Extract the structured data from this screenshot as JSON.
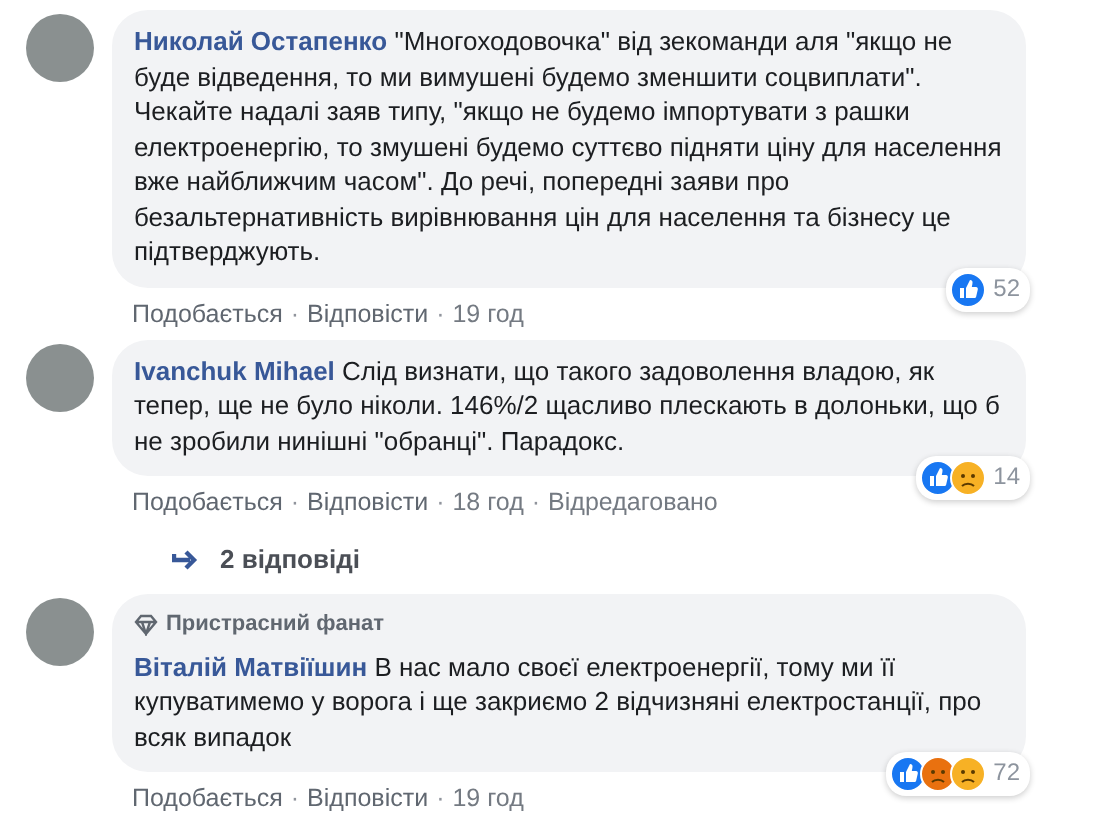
{
  "comments": [
    {
      "author": "Николай Остапенко",
      "text": "\"Многоходовочка\" від зекоманди аля \"якщо не буде відведення, то ми вимушені будемо зменшити соцвиплати\". Чекайте надалі заяв типу, \"якщо не будемо імпортувати з рашки електроенергію, то змушені будемо суттєво підняти ціну для населення вже найближчим часом\". До речі, попередні заяви про безальтернативність вирівнювання цін для населення та бізнесу це підтверджують.",
      "reactions": [
        {
          "kind": "like"
        }
      ],
      "reaction_count": "52",
      "meta": [
        {
          "kind": "link",
          "text": "Подобається"
        },
        {
          "kind": "dot",
          "text": "·"
        },
        {
          "kind": "link",
          "text": "Відповісти"
        },
        {
          "kind": "dot",
          "text": "·"
        },
        {
          "kind": "time",
          "text": "19 год"
        }
      ]
    },
    {
      "author": "Ivanchuk Mihael",
      "text": "Слід визнати, що такого задоволення владою, як тепер, ще не було ніколи. 146%/2 щасливо плескають в долоньки, що б не зробили нинішні \"обранці\". Парадокс.",
      "reactions": [
        {
          "kind": "like"
        },
        {
          "kind": "sad"
        }
      ],
      "reaction_count": "14",
      "meta": [
        {
          "kind": "link",
          "text": "Подобається"
        },
        {
          "kind": "dot",
          "text": "·"
        },
        {
          "kind": "link",
          "text": "Відповісти"
        },
        {
          "kind": "dot",
          "text": "·"
        },
        {
          "kind": "time",
          "text": "18 год"
        },
        {
          "kind": "dot",
          "text": "·"
        },
        {
          "kind": "time",
          "text": "Відредаговано"
        }
      ],
      "replies": "2 відповіді"
    },
    {
      "author": "Віталій Матвіїшин",
      "badge": "Пристрасний фанат",
      "text": "В нас мало своєї електроенергії, тому ми її купуватимемо у ворога і ще закриємо 2 відчизняні електростанції, про всяк випадок",
      "reactions": [
        {
          "kind": "like"
        },
        {
          "kind": "angry"
        },
        {
          "kind": "sad"
        }
      ],
      "reaction_count": "72",
      "meta": [
        {
          "kind": "link",
          "text": "Подобається"
        },
        {
          "kind": "dot",
          "text": "·"
        },
        {
          "kind": "link",
          "text": "Відповісти"
        },
        {
          "kind": "dot",
          "text": "·"
        },
        {
          "kind": "time",
          "text": "19 год"
        }
      ]
    }
  ]
}
